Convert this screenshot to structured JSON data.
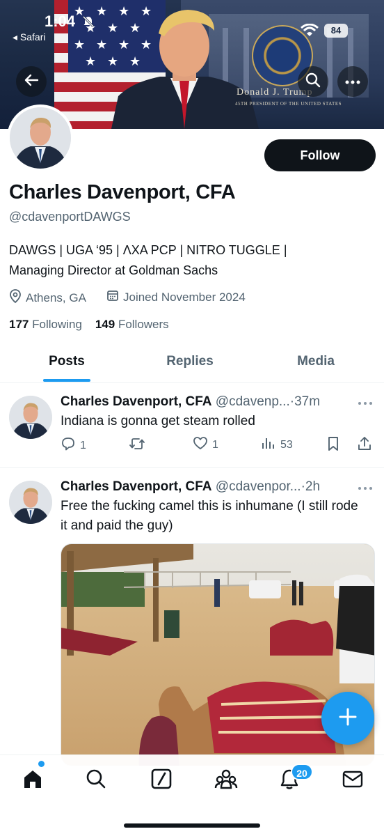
{
  "status_bar": {
    "time": "1:04",
    "back_app": "◂ Safari",
    "battery": "84"
  },
  "banner": {
    "seal_label": "Donald J. Trump",
    "seal_sub": "45TH PRESIDENT OF THE UNITED STATES"
  },
  "profile": {
    "name": "Charles Davenport, CFA",
    "handle": "@cdavenportDAWGS",
    "follow_label": "Follow",
    "bio_line1": "DAWGS | UGA ‘95 | ΛXA PCP | NITRO TUGGLE |",
    "bio_line2": "Managing Director at Goldman Sachs",
    "location": "Athens, GA",
    "joined": "Joined November 2024",
    "following_count": "177",
    "following_label": "Following",
    "followers_count": "149",
    "followers_label": "Followers"
  },
  "tabs": [
    {
      "label": "Posts"
    },
    {
      "label": "Replies"
    },
    {
      "label": "Media"
    }
  ],
  "posts": [
    {
      "name": "Charles Davenport, CFA",
      "handle": "@cdavenp...",
      "time": "·37m",
      "text": "Indiana is gonna get steam rolled",
      "replies": "1",
      "reposts": "",
      "likes": "1",
      "views": "53"
    },
    {
      "name": "Charles Davenport, CFA",
      "handle": "@cdavenpor...",
      "time": "·2h",
      "text": "Free the fucking camel this is inhumane (I still rode it and paid the guy)"
    }
  ],
  "nav": {
    "notifications_badge": "20"
  },
  "colors": {
    "accent": "#1d9bf0",
    "text": "#0f1419",
    "muted": "#536471"
  }
}
